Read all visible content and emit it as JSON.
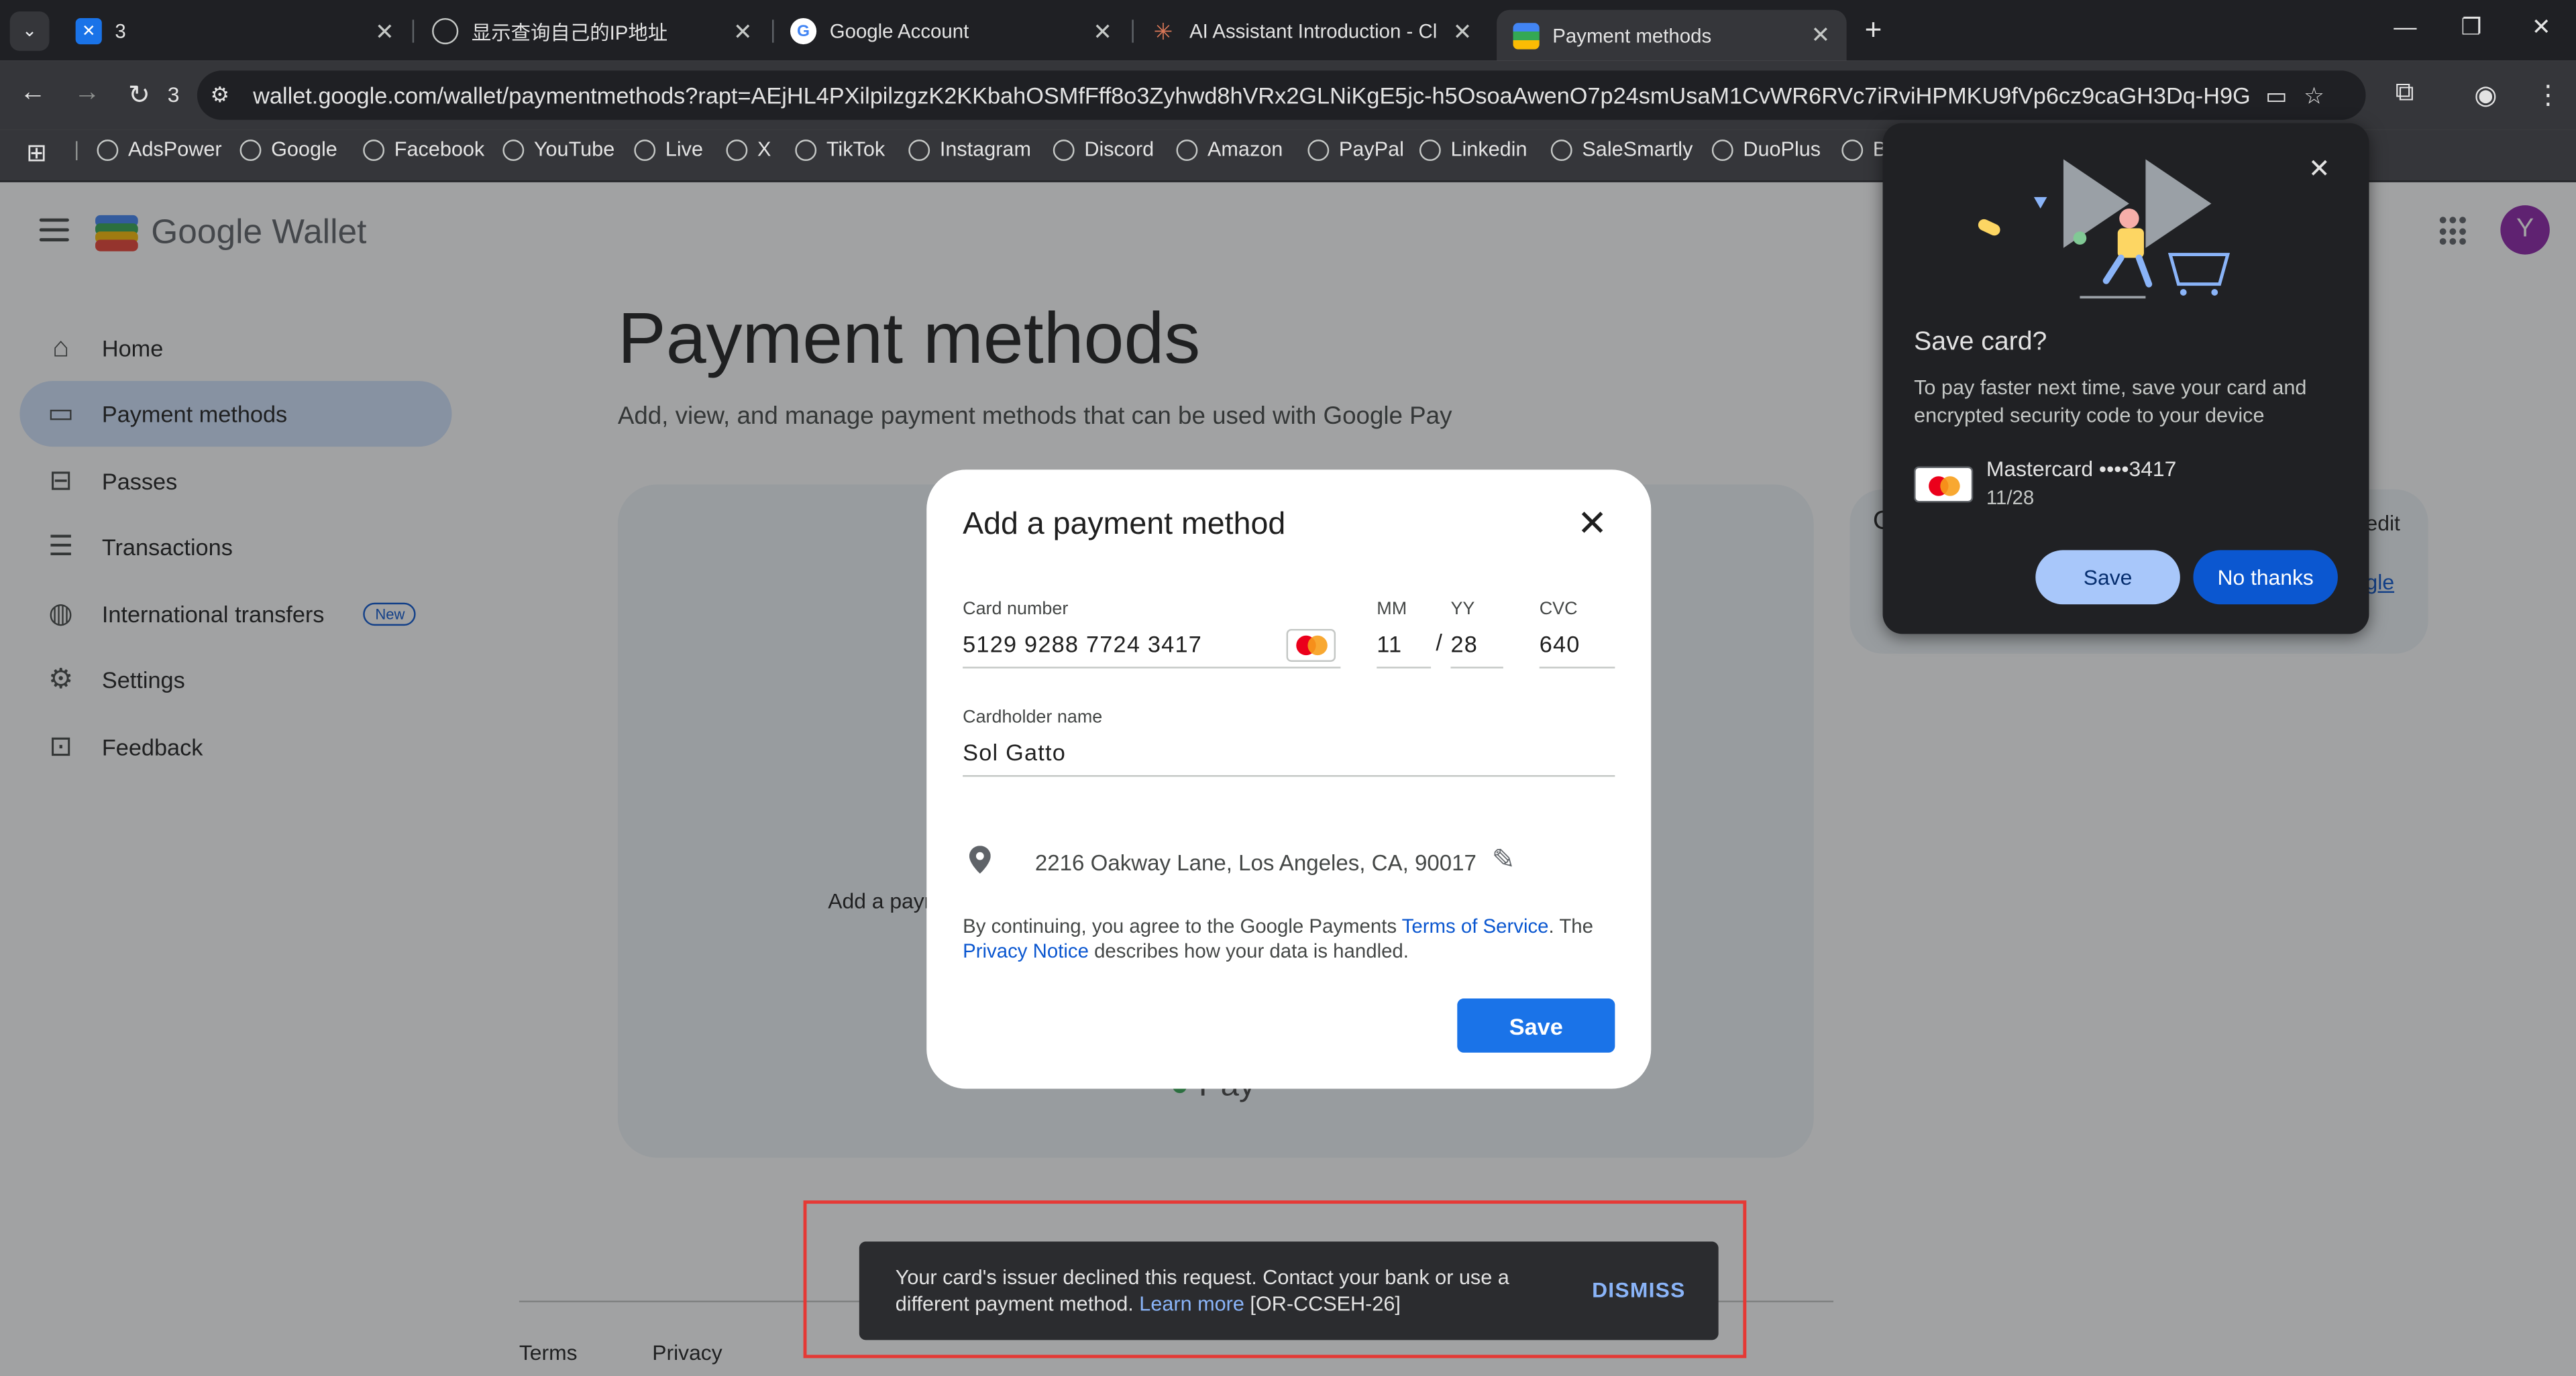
{
  "tabs": [
    {
      "title": "3",
      "favicon": "adspower-icon"
    },
    {
      "title": "显示查询自己的IP地址",
      "favicon": "globe-icon"
    },
    {
      "title": "Google Account",
      "favicon": "google-icon"
    },
    {
      "title": "AI Assistant Introduction - Cl",
      "favicon": "claude-icon"
    },
    {
      "title": "Payment methods",
      "favicon": "wallet-icon"
    }
  ],
  "toolbar": {
    "extension_count": "3",
    "url": "wallet.google.com/wallet/paymentmethods?rapt=AEjHL4PXilpilzgzK2KKbahOSMfFff8o3Zyhwd8hVRx2GLNiKgE5jc-h5OsoaAwenO7p24smUsaM1CvWR6RVc7iRviHPMKU9fVp6cz9caGH3Dq-H9GTGJ..."
  },
  "bookmarks": [
    "AdsPower",
    "Google",
    "Facebook",
    "YouTube",
    "Live",
    "X",
    "TikTok",
    "Instagram",
    "Discord",
    "Amazon",
    "PayPal",
    "Linkedin",
    "SaleSmartly",
    "DuoPlus",
    "B"
  ],
  "app": {
    "name": "Google Wallet",
    "avatar_letter": "Y"
  },
  "sidebar": {
    "items": [
      {
        "label": "Home",
        "icon": "home-icon"
      },
      {
        "label": "Payment methods",
        "icon": "credit-card-icon"
      },
      {
        "label": "Passes",
        "icon": "ticket-icon"
      },
      {
        "label": "Transactions",
        "icon": "list-icon"
      },
      {
        "label": "International transfers",
        "icon": "globe-icon",
        "badge": "New"
      },
      {
        "label": "Settings",
        "icon": "gear-icon"
      },
      {
        "label": "Feedback",
        "icon": "feedback-icon"
      }
    ]
  },
  "main": {
    "title": "Payment methods",
    "subtitle": "Add, view, and manage payment methods that can be used with Google Pay",
    "panel_text": "Add a payr",
    "right_panel_edit": "edit",
    "right_panel_link": "gle",
    "footer_links": [
      "Terms",
      "Privacy"
    ]
  },
  "dialog": {
    "title": "Add a payment method",
    "card_number_label": "Card number",
    "card_number": "5129  9288  7724  3417",
    "mm_label": "MM",
    "mm": "11",
    "yy_label": "YY",
    "yy": "28",
    "separator": "/",
    "cvc_label": "CVC",
    "cvc": "640",
    "cardholder_label": "Cardholder name",
    "cardholder": "Sol Gatto",
    "address": "2216 Oakway Lane, Los Angeles, CA, 90017",
    "legal_prefix": "By continuing, you agree to the Google Payments ",
    "legal_tos": "Terms of Service",
    "legal_mid": ". The ",
    "legal_privacy": "Privacy Notice",
    "legal_suffix": " describes how your data is handled.",
    "save_label": "Save"
  },
  "snackbar": {
    "text": "Your card's issuer declined this request. Contact your bank or use a different payment method. ",
    "link": "Learn more",
    "code": " [OR-CCSEH-26]",
    "dismiss": "DISMISS"
  },
  "save_card_bubble": {
    "title": "Save card?",
    "description": "To pay faster next time, save your card and encrypted security code to your device",
    "card_name": "Mastercard  ••••3417",
    "card_expiry": "11/28",
    "save_label": "Save",
    "no_thanks_label": "No thanks"
  },
  "colors": {
    "accent": "#1a73e8",
    "nav_active": "#d3e3fd",
    "error_box": "#e53935"
  }
}
